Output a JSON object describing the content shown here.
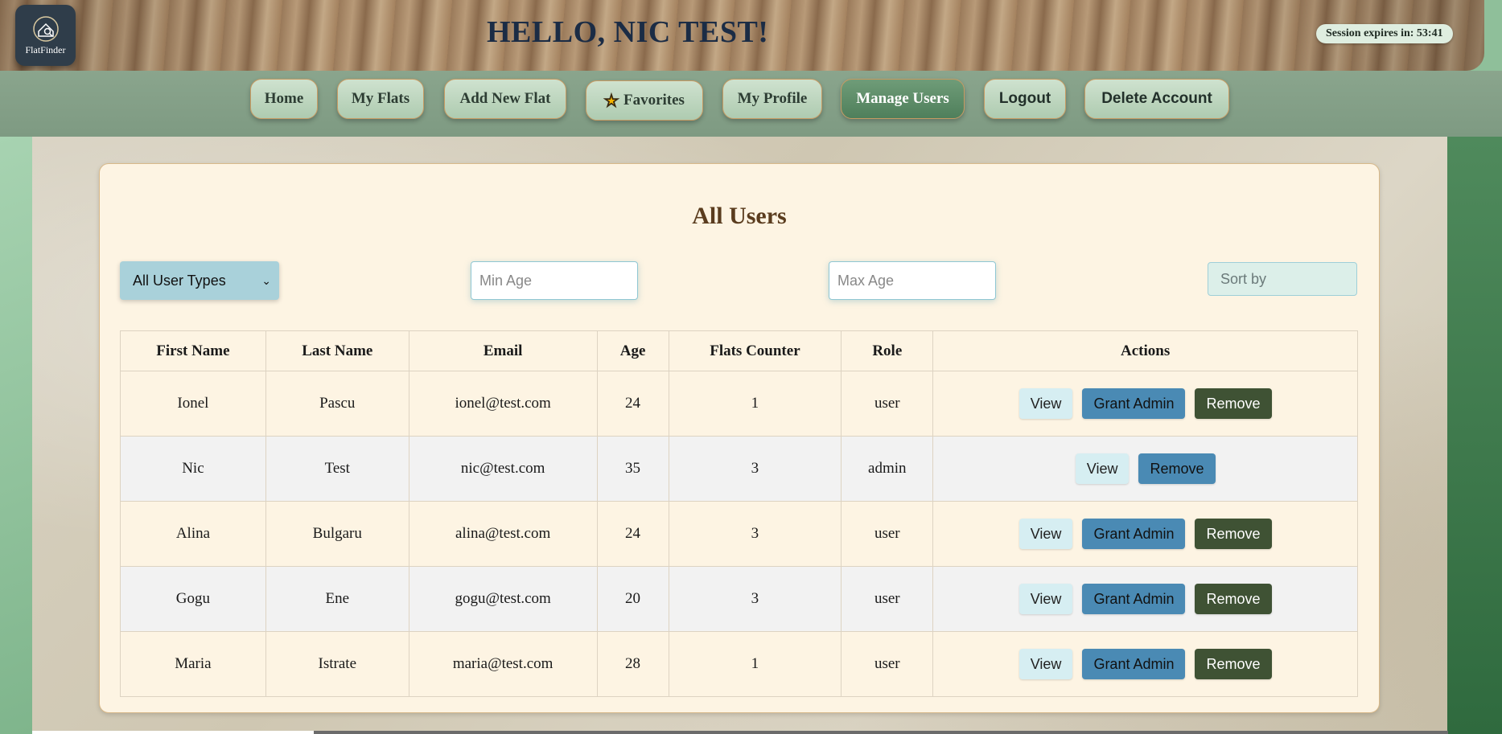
{
  "app": {
    "logo_text": "FlatFinder"
  },
  "header": {
    "greeting": "HELLO, NIC TEST!",
    "session": "Session expires in: 53:41"
  },
  "nav": {
    "home": "Home",
    "my_flats": "My Flats",
    "add_new_flat": "Add New Flat",
    "favorites": "Favorites",
    "my_profile": "My Profile",
    "manage_users": "Manage Users",
    "logout": "Logout",
    "delete_account": "Delete Account"
  },
  "main": {
    "title": "All Users",
    "filters": {
      "user_type_selected": "All User Types",
      "min_age_placeholder": "Min Age",
      "max_age_placeholder": "Max Age",
      "sort_placeholder": "Sort by"
    },
    "columns": [
      "First Name",
      "Last Name",
      "Email",
      "Age",
      "Flats Counter",
      "Role",
      "Actions"
    ],
    "actions": {
      "view": "View",
      "grant": "Grant Admin",
      "remove": "Remove"
    },
    "rows": [
      {
        "first": "Ionel",
        "last": "Pascu",
        "email": "ionel@test.com",
        "age": "24",
        "flats": "1",
        "role": "user"
      },
      {
        "first": "Nic",
        "last": "Test",
        "email": "nic@test.com",
        "age": "35",
        "flats": "3",
        "role": "admin"
      },
      {
        "first": "Alina",
        "last": "Bulgaru",
        "email": "alina@test.com",
        "age": "24",
        "flats": "3",
        "role": "user"
      },
      {
        "first": "Gogu",
        "last": "Ene",
        "email": "gogu@test.com",
        "age": "20",
        "flats": "3",
        "role": "user"
      },
      {
        "first": "Maria",
        "last": "Istrate",
        "email": "maria@test.com",
        "age": "28",
        "flats": "1",
        "role": "user"
      }
    ]
  },
  "colors": {
    "accent": "#4a8ab4",
    "remove": "#3f5234",
    "title": "#5a3c1e"
  }
}
